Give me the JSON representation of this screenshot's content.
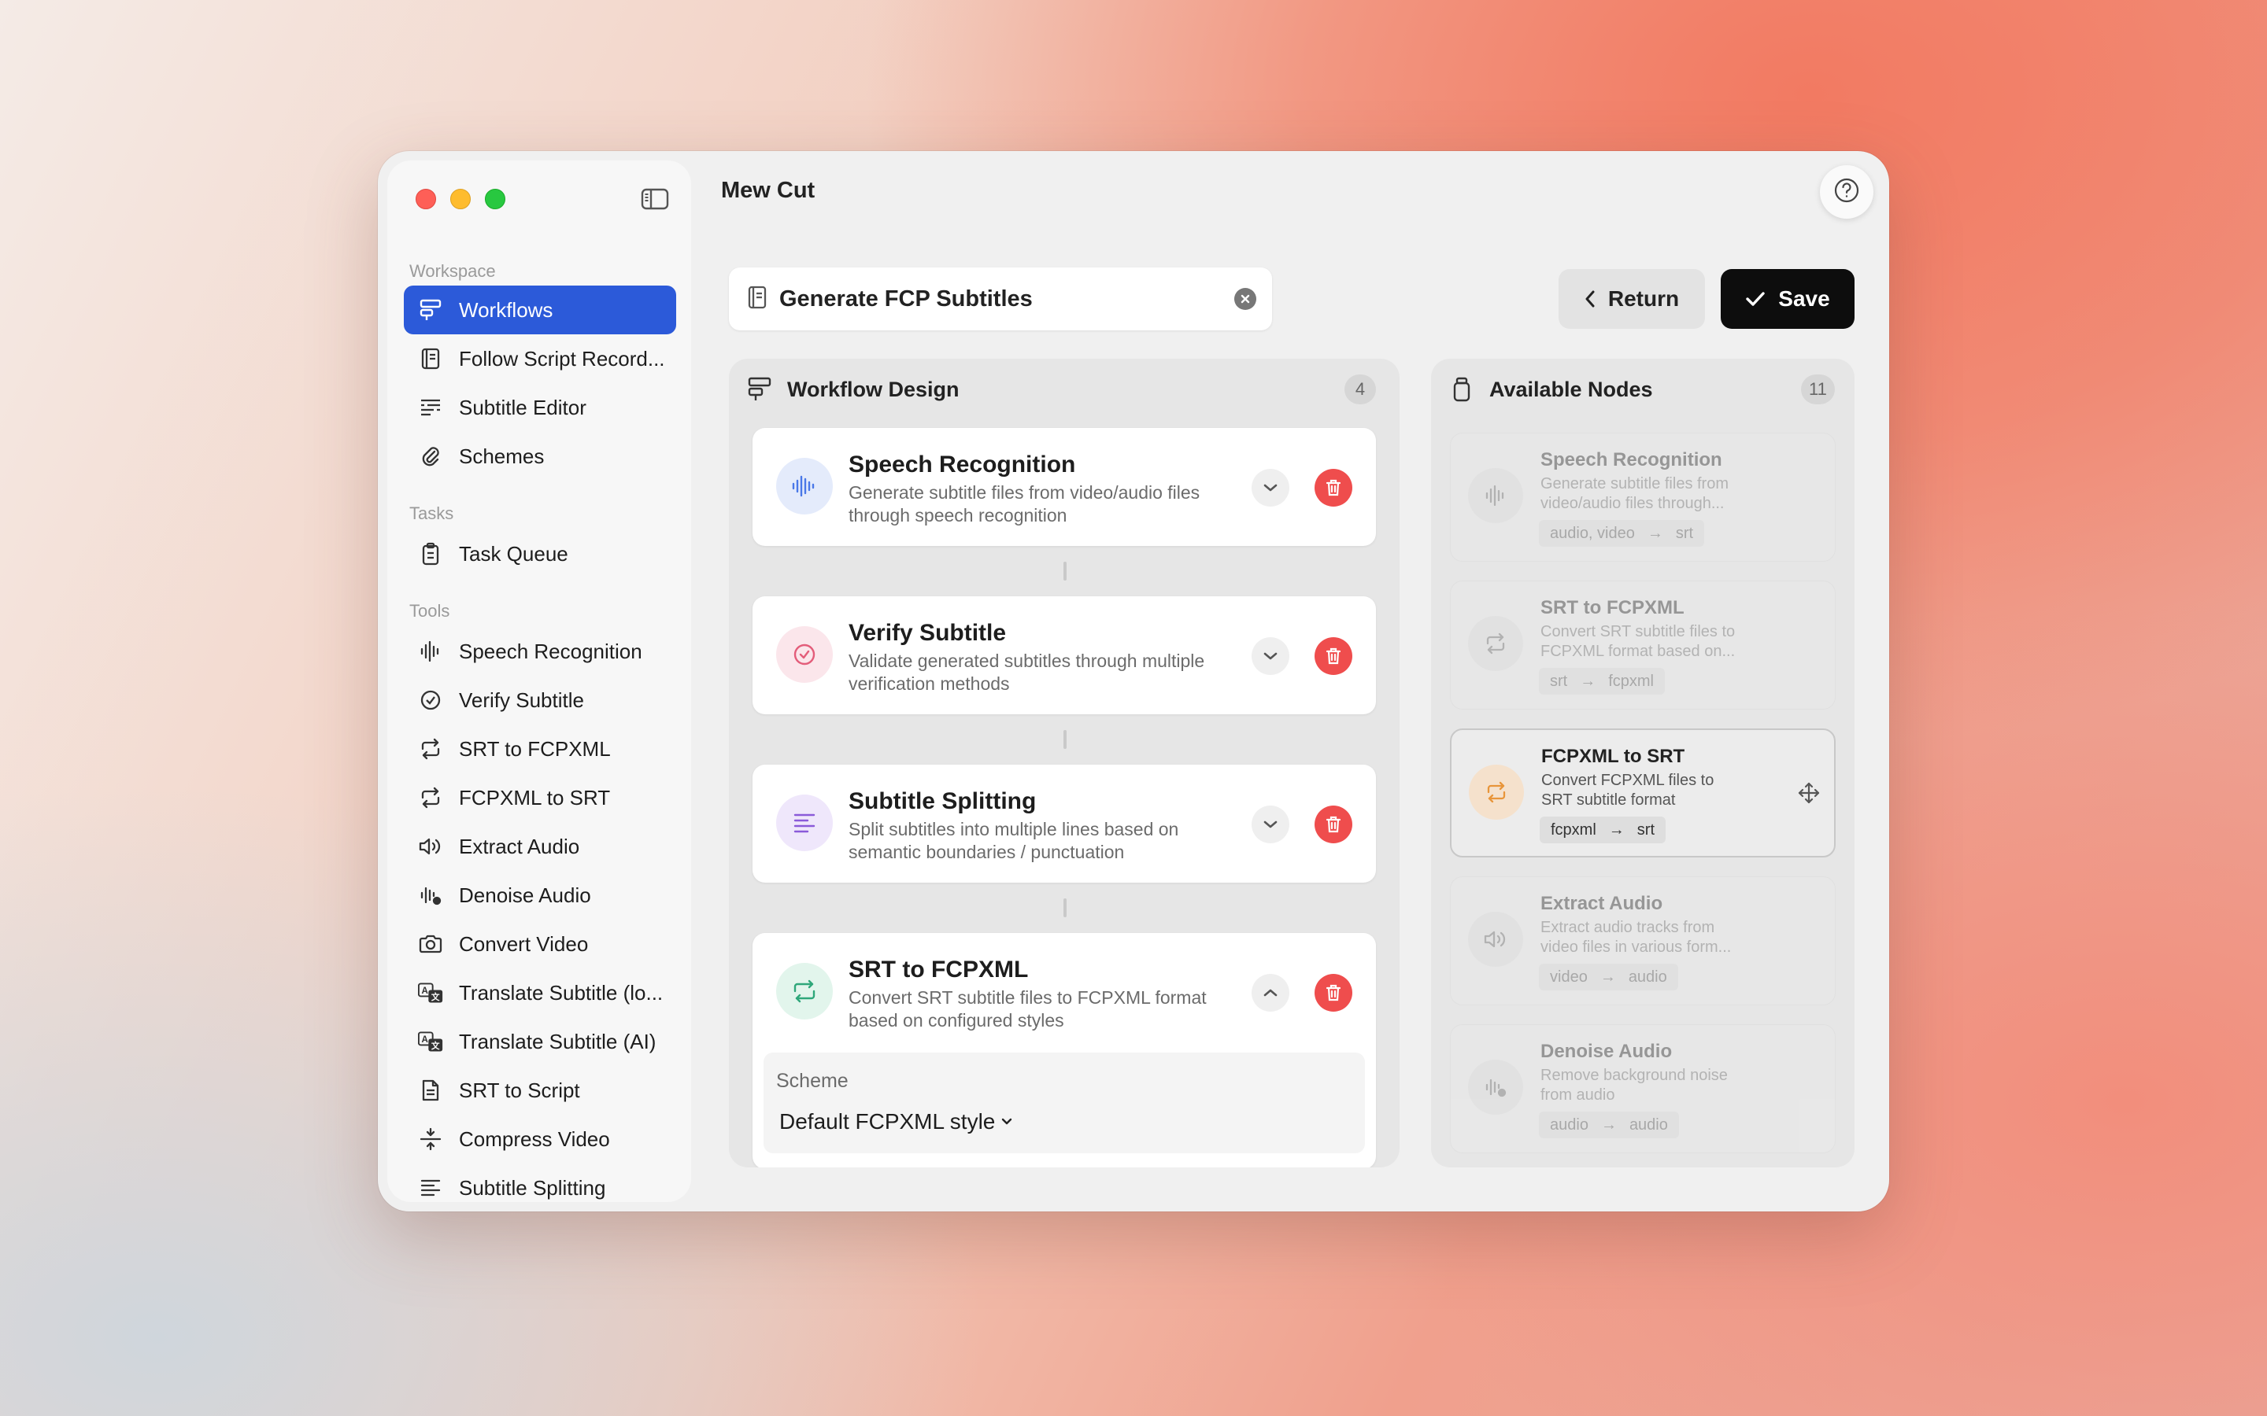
{
  "app": {
    "title": "Mew Cut"
  },
  "sidebar": {
    "workspace_label": "Workspace",
    "workspace_items": [
      {
        "label": "Workflows",
        "icon": "workflow-icon",
        "active": true
      },
      {
        "label": "Follow Script Record...",
        "icon": "script-book-icon"
      },
      {
        "label": "Subtitle Editor",
        "icon": "subtitle-editor-icon"
      },
      {
        "label": "Schemes",
        "icon": "paperclip-icon"
      }
    ],
    "tasks_label": "Tasks",
    "task_items": [
      {
        "label": "Task Queue",
        "icon": "clipboard-icon"
      }
    ],
    "tools_label": "Tools",
    "tool_items": [
      {
        "label": "Speech Recognition",
        "icon": "waveform-icon"
      },
      {
        "label": "Verify Subtitle",
        "icon": "check-circle-icon"
      },
      {
        "label": "SRT to FCPXML",
        "icon": "convert-arrows-icon"
      },
      {
        "label": "FCPXML to SRT",
        "icon": "convert-arrows-icon"
      },
      {
        "label": "Extract Audio",
        "icon": "speaker-icon"
      },
      {
        "label": "Denoise Audio",
        "icon": "denoise-icon"
      },
      {
        "label": "Convert Video",
        "icon": "camera-icon"
      },
      {
        "label": "Translate Subtitle (lo...",
        "icon": "translate-icon"
      },
      {
        "label": "Translate Subtitle (AI)",
        "icon": "translate-icon"
      },
      {
        "label": "SRT to Script",
        "icon": "document-icon"
      },
      {
        "label": "Compress Video",
        "icon": "compress-icon"
      },
      {
        "label": "Subtitle Splitting",
        "icon": "text-lines-icon"
      }
    ]
  },
  "editor": {
    "workflow_name": "Generate FCP Subtitles",
    "return_label": "Return",
    "save_label": "Save"
  },
  "design": {
    "title": "Workflow Design",
    "count": "4",
    "steps": [
      {
        "title": "Speech Recognition",
        "desc": "Generate subtitle files from video/audio files through speech recognition",
        "icon": "waveform-icon",
        "color": "#4a78e8",
        "bg": "#e4ebfb",
        "expanded": false
      },
      {
        "title": "Verify Subtitle",
        "desc": "Validate generated subtitles through multiple verification methods",
        "icon": "check-circle-icon",
        "color": "#e35d7a",
        "bg": "#fbe6eb",
        "expanded": false
      },
      {
        "title": "Subtitle Splitting",
        "desc": "Split subtitles into multiple lines based on semantic boundaries / punctuation",
        "icon": "text-lines-icon",
        "color": "#8a5ad9",
        "bg": "#efe7fb",
        "expanded": false
      },
      {
        "title": "SRT to FCPXML",
        "desc": "Convert SRT subtitle files to FCPXML format based on configured styles",
        "icon": "convert-arrows-icon",
        "color": "#2fa77a",
        "bg": "#e2f5ec",
        "expanded": true
      }
    ],
    "scheme": {
      "label": "Scheme",
      "value": "Default FCPXML style"
    }
  },
  "nodes": {
    "title": "Available Nodes",
    "count": "11",
    "items": [
      {
        "title": "Speech Recognition",
        "desc": "Generate subtitle files from video/audio files through...",
        "input": "audio, video",
        "output": "srt",
        "icon": "waveform-icon",
        "state": "disabled"
      },
      {
        "title": "SRT to FCPXML",
        "desc": "Convert SRT subtitle files to FCPXML format based on...",
        "input": "srt",
        "output": "fcpxml",
        "icon": "convert-arrows-icon",
        "state": "disabled"
      },
      {
        "title": "FCPXML to SRT",
        "desc": "Convert FCPXML files to SRT subtitle format",
        "input": "fcpxml",
        "output": "srt",
        "icon": "convert-arrows-icon",
        "state": "available",
        "accent": "#e8953a"
      },
      {
        "title": "Extract Audio",
        "desc": "Extract audio tracks from video files in various form...",
        "input": "video",
        "output": "audio",
        "icon": "speaker-icon",
        "state": "disabled"
      },
      {
        "title": "Denoise Audio",
        "desc": "Remove background noise from audio",
        "input": "audio",
        "output": "audio",
        "icon": "denoise-icon",
        "state": "disabled"
      }
    ]
  }
}
